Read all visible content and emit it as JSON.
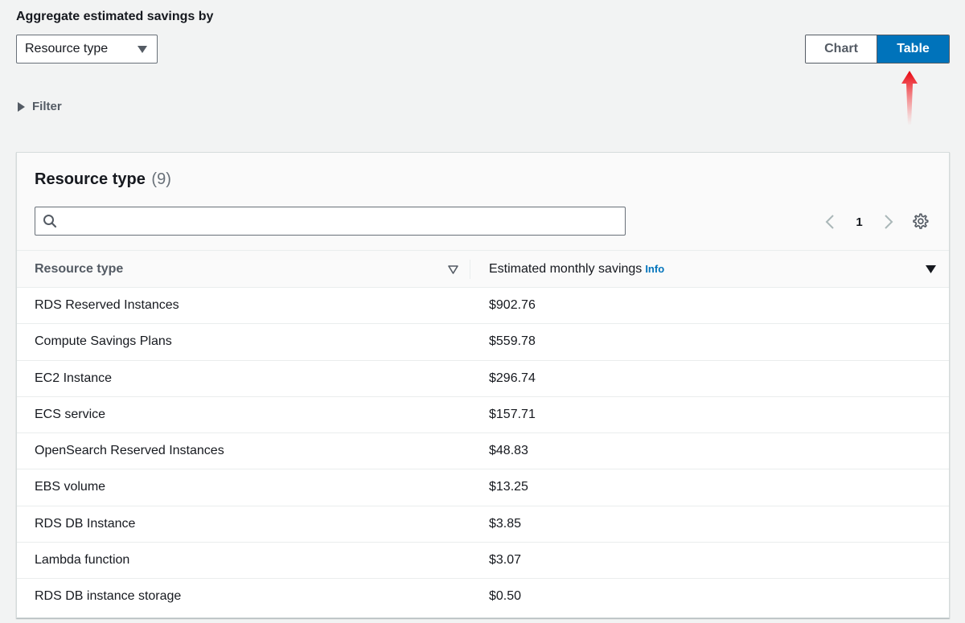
{
  "aggregate": {
    "label": "Aggregate estimated savings by",
    "selected": "Resource type"
  },
  "view_toggle": {
    "chart_label": "Chart",
    "table_label": "Table",
    "active": "Table",
    "active_color": "#0073bb"
  },
  "filter": {
    "label": "Filter"
  },
  "table": {
    "title": "Resource type",
    "count": "(9)",
    "search_value": "",
    "page": "1",
    "columns": {
      "resource_type": "Resource type",
      "savings": "Estimated monthly savings",
      "savings_info": "Info"
    },
    "rows": [
      {
        "resource_type": "RDS Reserved Instances",
        "savings": "$902.76"
      },
      {
        "resource_type": "Compute Savings Plans",
        "savings": "$559.78"
      },
      {
        "resource_type": "EC2 Instance",
        "savings": "$296.74"
      },
      {
        "resource_type": "ECS service",
        "savings": "$157.71"
      },
      {
        "resource_type": "OpenSearch Reserved Instances",
        "savings": "$48.83"
      },
      {
        "resource_type": "EBS volume",
        "savings": "$13.25"
      },
      {
        "resource_type": "RDS DB Instance",
        "savings": "$3.85"
      },
      {
        "resource_type": "Lambda function",
        "savings": "$3.07"
      },
      {
        "resource_type": "RDS DB instance storage",
        "savings": "$0.50"
      }
    ]
  },
  "icons": {
    "dropdown": "caret-down-icon",
    "filter_toggle": "caret-right-icon",
    "search": "search-icon",
    "prev": "chevron-left-icon",
    "next": "chevron-right-icon",
    "settings": "gear-icon",
    "annotation": "red-arrow-up-icon"
  }
}
